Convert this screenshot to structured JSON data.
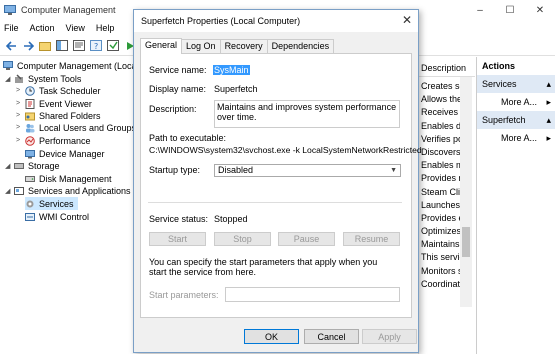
{
  "window": {
    "title": "Computer Management"
  },
  "menu": [
    "File",
    "Action",
    "View",
    "Help"
  ],
  "tree": {
    "root": "Computer Management (Local",
    "system_tools": "System Tools",
    "task_scheduler": "Task Scheduler",
    "event_viewer": "Event Viewer",
    "shared_folders": "Shared Folders",
    "local_users": "Local Users and Groups",
    "performance": "Performance",
    "device_manager": "Device Manager",
    "storage": "Storage",
    "disk_management": "Disk Management",
    "services_apps": "Services and Applications",
    "services": "Services",
    "wmi": "WMI Control"
  },
  "list": {
    "header": "Description",
    "rows": [
      "Creates soft",
      "Allows the s",
      "Receives tra",
      "Enables det",
      "Verifies pot",
      "Discovers n",
      "Enables mul",
      "Provides re",
      "Steam Clier",
      "Launches a",
      "Provides en",
      "Optimizes t",
      "Maintains a",
      "This service",
      "Monitors sy",
      "Coordinate"
    ]
  },
  "actions": {
    "header": "Actions",
    "section1": "Services",
    "more1": "More A...",
    "section2": "Superfetch",
    "more2": "More A..."
  },
  "dialog": {
    "title": "Superfetch Properties (Local Computer)",
    "tabs": [
      "General",
      "Log On",
      "Recovery",
      "Dependencies"
    ],
    "service_name_label": "Service name:",
    "service_name": "SysMain",
    "display_name_label": "Display name:",
    "display_name": "Superfetch",
    "description_label": "Description:",
    "description": "Maintains and improves system performance over time.",
    "path_label": "Path to executable:",
    "path": "C:\\WINDOWS\\system32\\svchost.exe -k LocalSystemNetworkRestricted",
    "startup_label": "Startup type:",
    "startup_value": "Disabled",
    "status_label": "Service status:",
    "status_value": "Stopped",
    "btn_start": "Start",
    "btn_stop": "Stop",
    "btn_pause": "Pause",
    "btn_resume": "Resume",
    "hint": "You can specify the start parameters that apply when you start the service from here.",
    "params_label": "Start parameters:",
    "ok": "OK",
    "cancel": "Cancel",
    "apply": "Apply"
  }
}
